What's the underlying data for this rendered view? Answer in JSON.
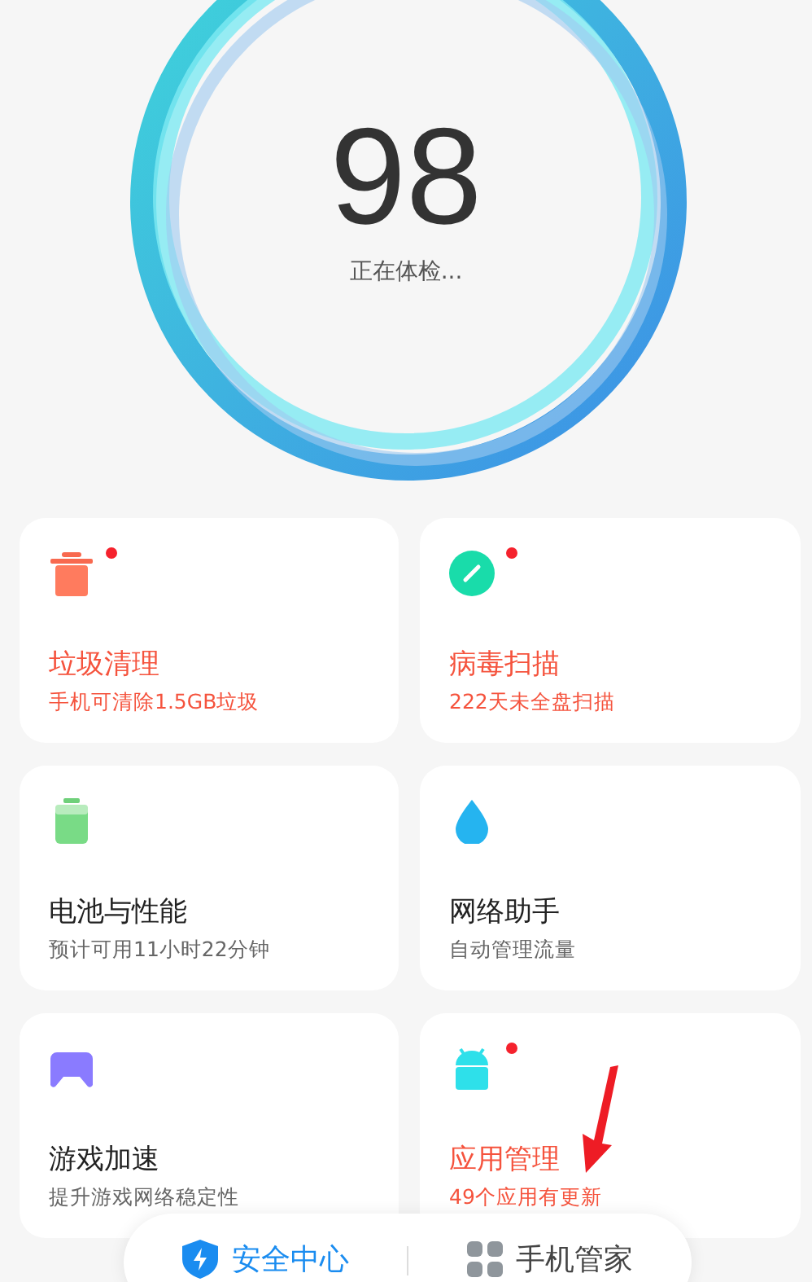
{
  "score": {
    "value": "98",
    "status": "正在体检..."
  },
  "cards": [
    {
      "kind": "trash",
      "title": "垃圾清理",
      "subtitle": "手机可清除1.5GB垃圾",
      "alert": true
    },
    {
      "kind": "gauge",
      "title": "病毒扫描",
      "subtitle": "222天未全盘扫描",
      "alert": true
    },
    {
      "kind": "battery",
      "title": "电池与性能",
      "subtitle": "预计可用11小时22分钟",
      "alert": false
    },
    {
      "kind": "drop",
      "title": "网络助手",
      "subtitle": "自动管理流量",
      "alert": false
    },
    {
      "kind": "gamepad",
      "title": "游戏加速",
      "subtitle": "提升游戏网络稳定性",
      "alert": false
    },
    {
      "kind": "android",
      "title": "应用管理",
      "subtitle": "49个应用有更新",
      "alert": true
    }
  ],
  "tabs": [
    {
      "label": "安全中心",
      "selected": true
    },
    {
      "label": "手机管家",
      "selected": false
    }
  ]
}
